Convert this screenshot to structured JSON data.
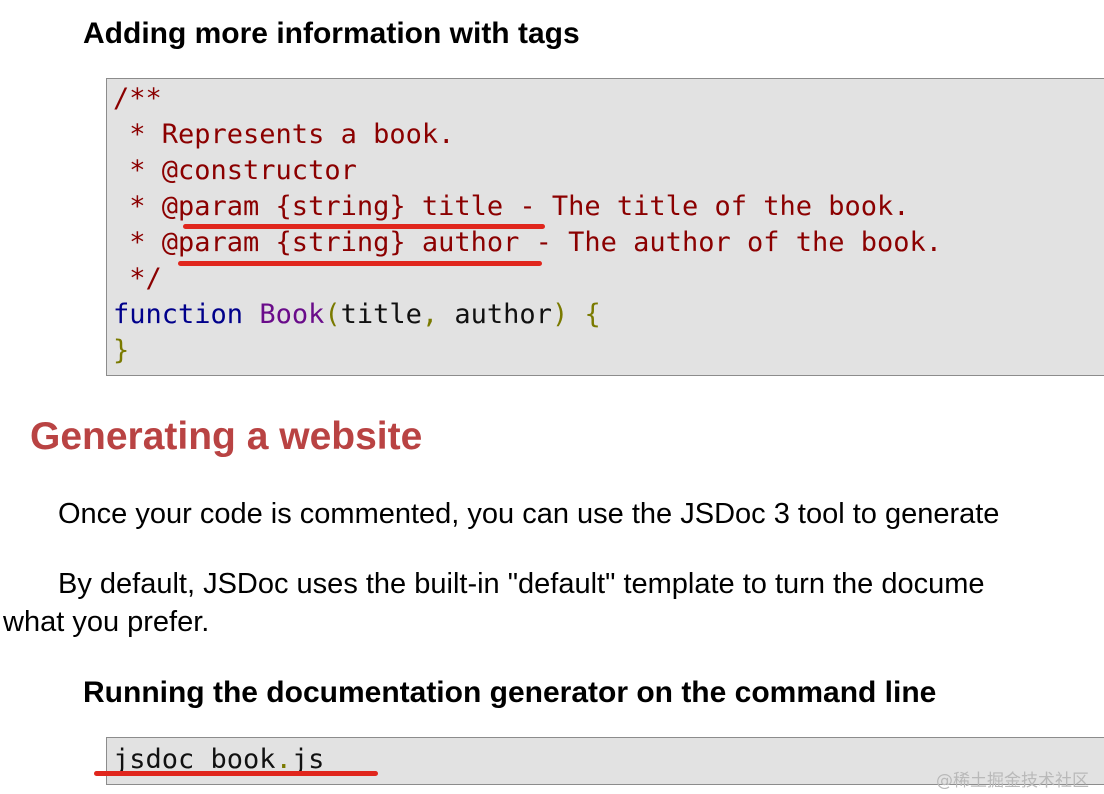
{
  "section1": {
    "heading": "Adding more information with tags",
    "code_lines": [
      {
        "parts": [
          {
            "cls": "cm",
            "text": "/**"
          }
        ]
      },
      {
        "parts": [
          {
            "cls": "cm",
            "text": " * Represents a book."
          }
        ]
      },
      {
        "parts": [
          {
            "cls": "cm",
            "text": " * @constructor"
          }
        ]
      },
      {
        "parts": [
          {
            "cls": "cm",
            "text": " * @param {string} title - The title of the book."
          }
        ]
      },
      {
        "parts": [
          {
            "cls": "cm",
            "text": " * @param {string} author - The author of the book."
          }
        ]
      },
      {
        "parts": [
          {
            "cls": "cm",
            "text": " */"
          }
        ]
      },
      {
        "parts": [
          {
            "cls": "kw",
            "text": "function"
          },
          {
            "cls": "pl",
            "text": " "
          },
          {
            "cls": "fn",
            "text": "Book"
          },
          {
            "cls": "br",
            "text": "("
          },
          {
            "cls": "pl",
            "text": "title"
          },
          {
            "cls": "br",
            "text": ","
          },
          {
            "cls": "pl",
            "text": " author"
          },
          {
            "cls": "br",
            "text": ")"
          },
          {
            "cls": "pl",
            "text": " "
          },
          {
            "cls": "br",
            "text": "{"
          }
        ]
      },
      {
        "parts": [
          {
            "cls": "br",
            "text": "}"
          }
        ]
      }
    ]
  },
  "section2": {
    "heading": "Generating a website",
    "para1": "Once your code is commented, you can use the JSDoc 3 tool to generate",
    "para2_line1": "By default, JSDoc uses the built-in \"default\" template to turn the docume",
    "para2_line2": "what you prefer."
  },
  "section3": {
    "heading": "Running the documentation generator on the command line",
    "code_lines": [
      {
        "parts": [
          {
            "cls": "pl",
            "text": "jsdoc book"
          },
          {
            "cls": "br",
            "text": "."
          },
          {
            "cls": "pl",
            "text": "js"
          }
        ]
      }
    ]
  },
  "colors": {
    "heading_red": "#b94343",
    "comment": "#8b0000",
    "keyword": "#00008b",
    "function_name": "#6a0c8a",
    "punctuation": "#7a7a00",
    "code_background": "#e2e2e2",
    "annotation_underline": "#e0261d"
  },
  "watermark": "@稀土掘金技术社区"
}
